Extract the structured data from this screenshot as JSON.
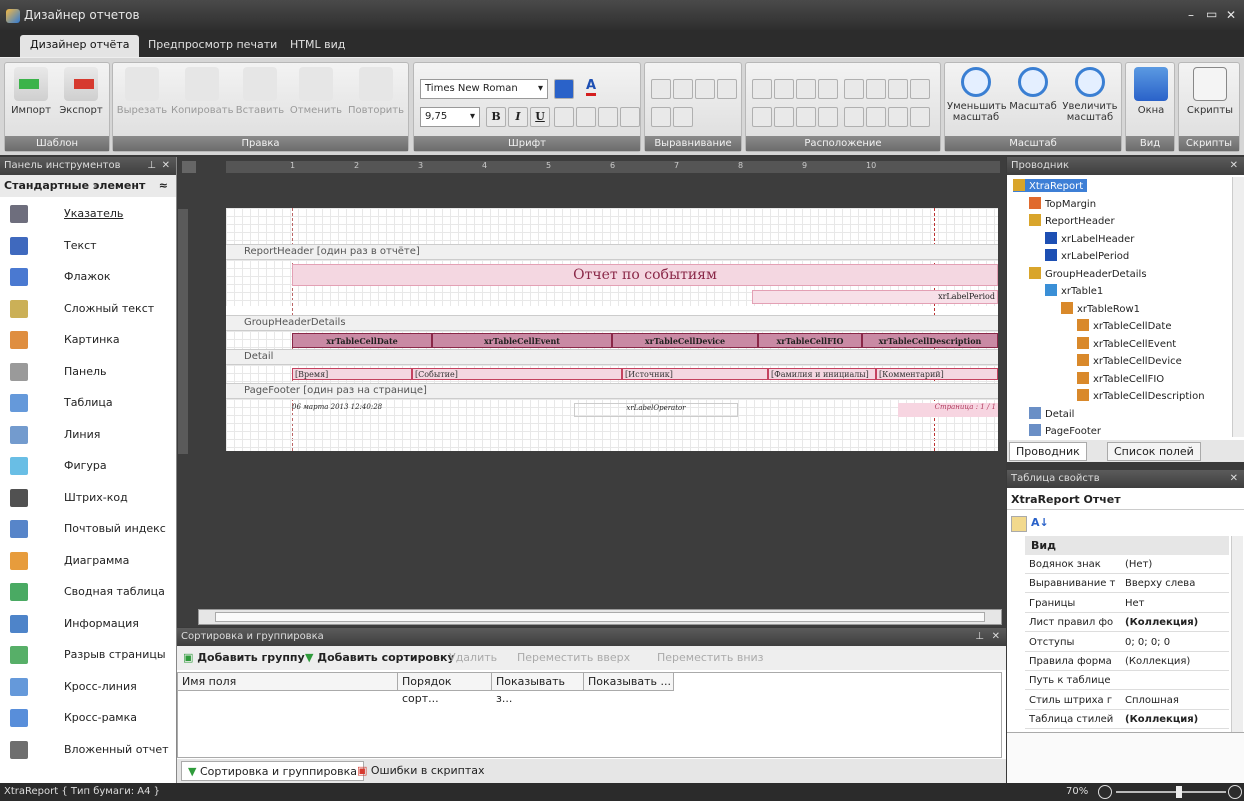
{
  "window": {
    "title": "Дизайнер отчетов",
    "min": "–",
    "max": "▭",
    "close": "✕"
  },
  "tabs": [
    "Дизайнер отчёта",
    "Предпросмотр печати",
    "HTML вид"
  ],
  "ribbon": {
    "template": {
      "caption": "Шаблон",
      "import": "Импорт",
      "export": "Экспорт"
    },
    "edit": {
      "caption": "Правка",
      "cut": "Вырезать",
      "copy": "Копировать",
      "paste": "Вставить",
      "undo": "Отменить",
      "redo": "Повторить"
    },
    "font": {
      "caption": "Шрифт",
      "name": "Times New Roman",
      "size": "9,75",
      "bold": "B",
      "italic": "I",
      "underline": "U"
    },
    "align": {
      "caption": "Выравнивание"
    },
    "layout": {
      "caption": "Расположение"
    },
    "zoom": {
      "caption": "Масштаб",
      "out": "Уменьшить масштаб",
      "zoom": "Масштаб",
      "in": "Увеличить масштаб"
    },
    "view": {
      "caption": "Вид",
      "windows": "Окна"
    },
    "scripts": {
      "caption": "Скрипты",
      "scripts": "Скрипты"
    }
  },
  "toolbox": {
    "title": "Панель инструментов",
    "group": "Стандартные элемент",
    "items": [
      {
        "label": "Указатель",
        "icon": "pointer-icon"
      },
      {
        "label": "Текст",
        "icon": "text-icon"
      },
      {
        "label": "Флажок",
        "icon": "checkbox-icon"
      },
      {
        "label": "Сложный текст",
        "icon": "richtext-icon"
      },
      {
        "label": "Картинка",
        "icon": "picture-icon"
      },
      {
        "label": "Панель",
        "icon": "panel-icon"
      },
      {
        "label": "Таблица",
        "icon": "table-icon"
      },
      {
        "label": "Линия",
        "icon": "line-icon"
      },
      {
        "label": "Фигура",
        "icon": "shape-icon"
      },
      {
        "label": "Штрих-код",
        "icon": "barcode-icon"
      },
      {
        "label": "Почтовый индекс",
        "icon": "zipcode-icon"
      },
      {
        "label": "Диаграмма",
        "icon": "chart-icon"
      },
      {
        "label": "Сводная таблица",
        "icon": "pivot-icon"
      },
      {
        "label": "Информация",
        "icon": "info-icon"
      },
      {
        "label": "Разрыв страницы",
        "icon": "pagebreak-icon"
      },
      {
        "label": "Кросс-линия",
        "icon": "crossline-icon"
      },
      {
        "label": "Кросс-рамка",
        "icon": "crossbox-icon"
      },
      {
        "label": "Вложенный отчет",
        "icon": "subreport-icon"
      }
    ]
  },
  "report": {
    "rulerNums": [
      "1",
      "2",
      "3",
      "4",
      "5",
      "6",
      "7",
      "8",
      "9",
      "10"
    ],
    "bands": {
      "reportHeader": "ReportHeader [один раз в отчёте]",
      "groupHeader": "GroupHeaderDetails",
      "detail": "Detail",
      "pageFooter": "PageFooter [один раз на странице]"
    },
    "title": "Отчет по событиям",
    "period": "xrLabelPeriod",
    "headCells": [
      "xrTableCellDate",
      "xrTableCellEvent",
      "xrTableCellDevice",
      "xrTableCellFIO",
      "xrTableCellDescription"
    ],
    "detailCells": [
      "[Время]",
      "[Событие]",
      "[Источник]",
      "[Фамилия и инициалы]",
      "[Комментарий]"
    ],
    "footer": {
      "date": "06 марта 2013 12:40:28",
      "operator": "xrLabelOperator",
      "page": "Страница : 1 / 1"
    }
  },
  "sort": {
    "title": "Сортировка и группировка",
    "addGroup": "Добавить группу",
    "addSort": "Добавить сортировку",
    "delete": "Удалить",
    "up": "Переместить вверх",
    "down": "Переместить вниз",
    "cols": [
      "Имя поля",
      "Порядок сорт...",
      "Показывать з...",
      "Показывать ..."
    ],
    "tabs": [
      "Сортировка и группировка",
      "Ошибки в скриптах"
    ]
  },
  "explorer": {
    "title": "Проводник",
    "nodes": [
      "XtraReport",
      "TopMargin",
      "ReportHeader",
      "xrLabelHeader",
      "xrLabelPeriod",
      "GroupHeaderDetails",
      "xrTable1",
      "xrTableRow1",
      "xrTableCellDate",
      "xrTableCellEvent",
      "xrTableCellDevice",
      "xrTableCellFIO",
      "xrTableCellDescription",
      "Detail",
      "PageFooter"
    ],
    "tabs": [
      "Проводник",
      "Список полей"
    ]
  },
  "props": {
    "title": "Таблица свойств",
    "object": "XtraReport",
    "objtype": "Отчет",
    "category": "Вид",
    "rows": [
      [
        "Водянок знак",
        "(Нет)"
      ],
      [
        "Выравнивание т",
        "Вверху слева"
      ],
      [
        "Границы",
        "Нет"
      ],
      [
        "Лист правил фо",
        "(Коллекция)"
      ],
      [
        "Отступы",
        "0; 0; 0; 0"
      ],
      [
        "Правила форма",
        "(Коллекция)"
      ],
      [
        "Путь к таблице",
        ""
      ],
      [
        "Стиль штриха г",
        "Сплошная"
      ],
      [
        "Таблица стилей",
        "(Коллекция)"
      ]
    ]
  },
  "status": {
    "left": "XtraReport { Тип бумаги: A4 }",
    "zoom": "70%"
  },
  "colors": {
    "accent": "#c4425f",
    "selection": "#3d7fd6"
  }
}
